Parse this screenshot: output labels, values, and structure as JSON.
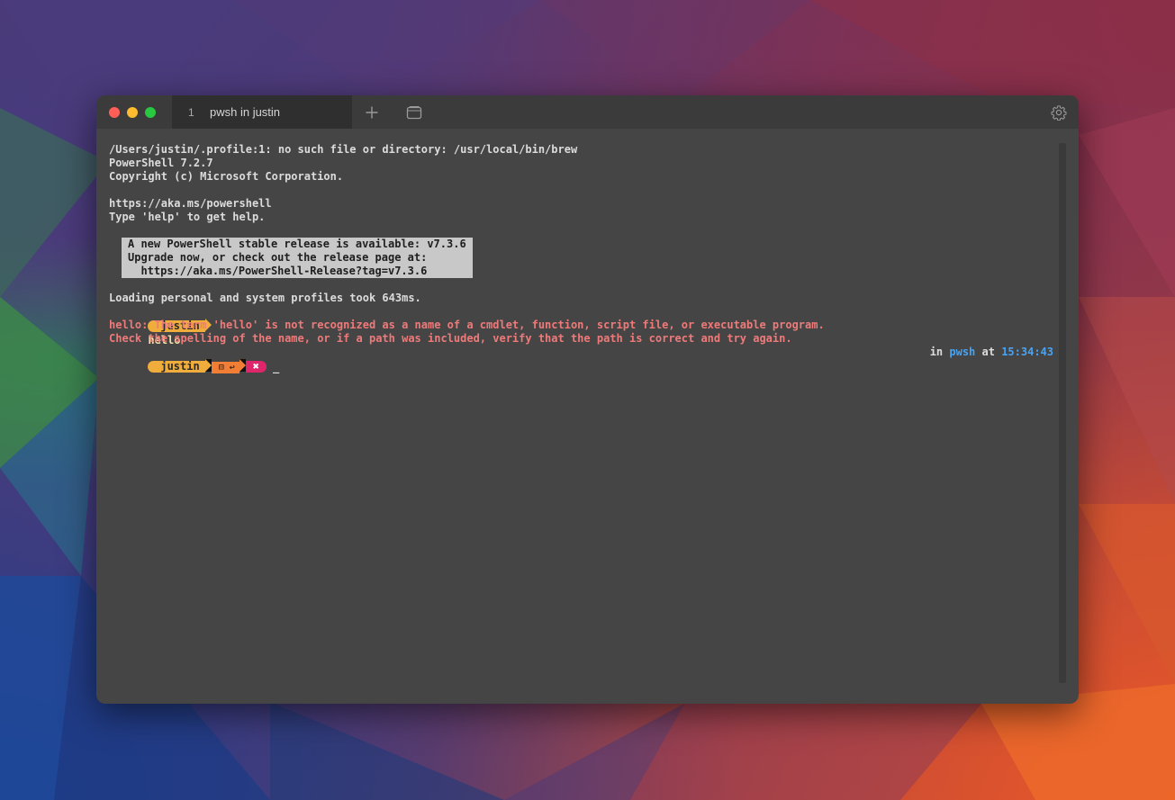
{
  "window": {
    "tab": {
      "index": "1",
      "title": "pwsh in justin"
    },
    "icons": {
      "new_tab": "plus-icon",
      "tab_overview": "tab-overview-icon",
      "settings": "gear-icon"
    }
  },
  "terminal": {
    "lines": [
      "/Users/justin/.profile:1: no such file or directory: /usr/local/bin/brew",
      "PowerShell 7.2.7",
      "Copyright (c) Microsoft Corporation.",
      "",
      "https://aka.ms/powershell",
      "Type 'help' to get help."
    ],
    "banner": [
      "A new PowerShell stable release is available: v7.3.6",
      "Upgrade now, or check out the release page at:",
      "  https://aka.ms/PowerShell-Release?tag=v7.3.6"
    ],
    "loading": "Loading personal and system profiles took 643ms.",
    "prompt1": {
      "user": "justin",
      "command": "hello"
    },
    "errors": [
      "hello: The term 'hello' is not recognized as a name of a cmdlet, function, script file, or executable program.",
      "Check the spelling of the name, or if a path was included, verify that the path is correct and try again."
    ],
    "prompt2": {
      "user": "justin",
      "git_segment": "⊟ ↩",
      "status_symbol": "✖",
      "cursor": "_",
      "right": {
        "in_label": "in",
        "shell": "pwsh",
        "at_label": "at",
        "time": "15:34:43"
      }
    }
  },
  "colors": {
    "prompt_user": "#f0ad3b",
    "prompt_git": "#f27d34",
    "prompt_error": "#e0266a",
    "error_text": "#ef7a7a",
    "accent_blue": "#4aa3f0"
  }
}
